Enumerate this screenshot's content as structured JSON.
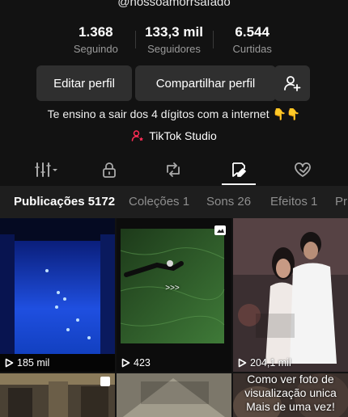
{
  "profile": {
    "handle": "@nossoamorrsafado",
    "bio": "Te ensino a sair dos 4 dígitos com a internet 👇👇",
    "studio_link": "TikTok Studio"
  },
  "stats": [
    {
      "value": "1.368",
      "label": "Seguindo"
    },
    {
      "value": "133,3 mil",
      "label": "Seguidores"
    },
    {
      "value": "6.544",
      "label": "Curtidas"
    }
  ],
  "buttons": {
    "edit": "Editar perfil",
    "share": "Compartilhar perfil",
    "add_friend_icon": "add-user-icon"
  },
  "icon_tabs": [
    {
      "icon": "grid-filter-icon"
    },
    {
      "icon": "lock-icon"
    },
    {
      "icon": "repost-icon"
    },
    {
      "icon": "saved-icon",
      "active": true
    },
    {
      "icon": "liked-heart-icon"
    }
  ],
  "text_tabs": [
    "Publicações 5172",
    "Coleções 1",
    "Sons 26",
    "Efeitos 1",
    "Pr"
  ],
  "videos": [
    {
      "views": "185 mil"
    },
    {
      "views": "423",
      "center_text": ">>>"
    },
    {
      "views": "204,1 mil"
    },
    {
      "views": ""
    },
    {
      "views": ""
    },
    {
      "views": "",
      "caption": "Como ver foto de visualização unica Mais de uma vez!"
    }
  ],
  "colors": {
    "background": "#121212",
    "button": "#2f2f2f",
    "studio_accent": "#fe2c55"
  }
}
